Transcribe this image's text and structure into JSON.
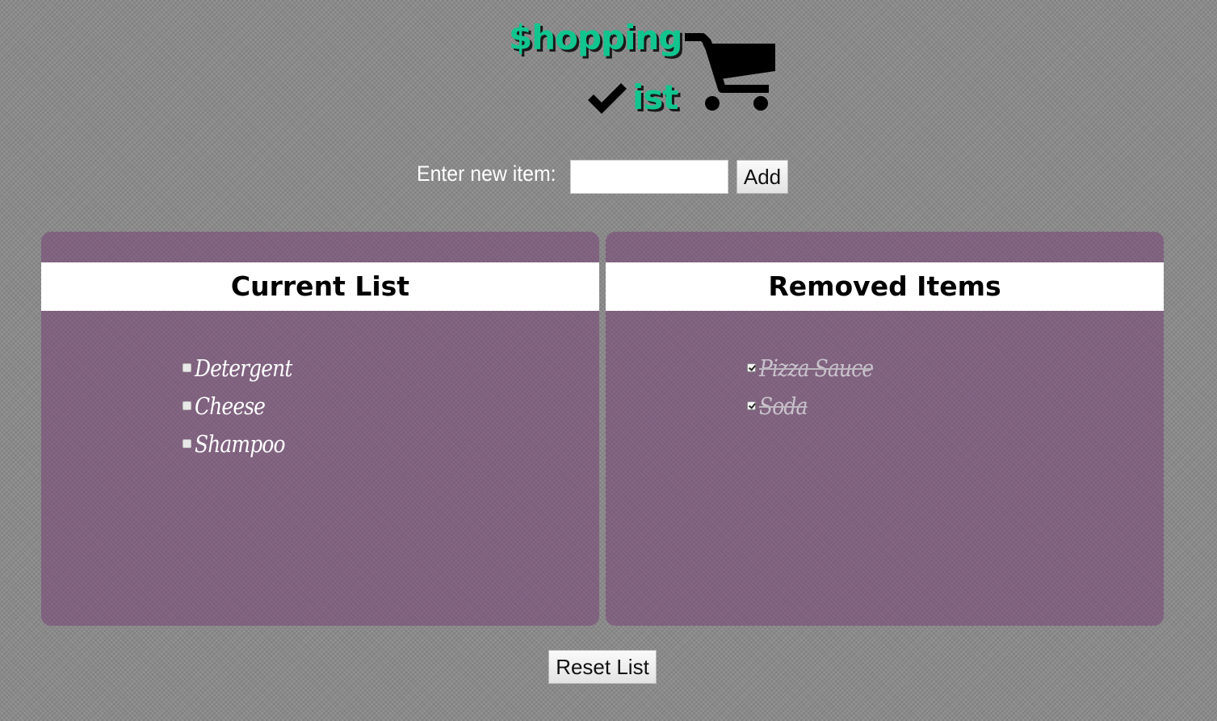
{
  "logo": {
    "word_top": "$hopping",
    "word_bottom": "ist",
    "check_icon": "checkmark-icon",
    "cart_icon": "shopping-cart-icon",
    "accent_color": "#11c58f"
  },
  "entry": {
    "label": "Enter new item:",
    "value": "",
    "placeholder": "",
    "add_label": "Add"
  },
  "current_list": {
    "heading": "Current List",
    "items": [
      {
        "label": "Detergent",
        "checked": false
      },
      {
        "label": "Cheese",
        "checked": false
      },
      {
        "label": "Shampoo",
        "checked": false
      }
    ]
  },
  "removed_items": {
    "heading": "Removed Items",
    "items": [
      {
        "label": "Pizza Sauce",
        "checked": true
      },
      {
        "label": "Soda",
        "checked": true
      }
    ]
  },
  "reset_label": "Reset List",
  "colors": {
    "panel": "#80627f",
    "background": "#8a8a8a"
  }
}
